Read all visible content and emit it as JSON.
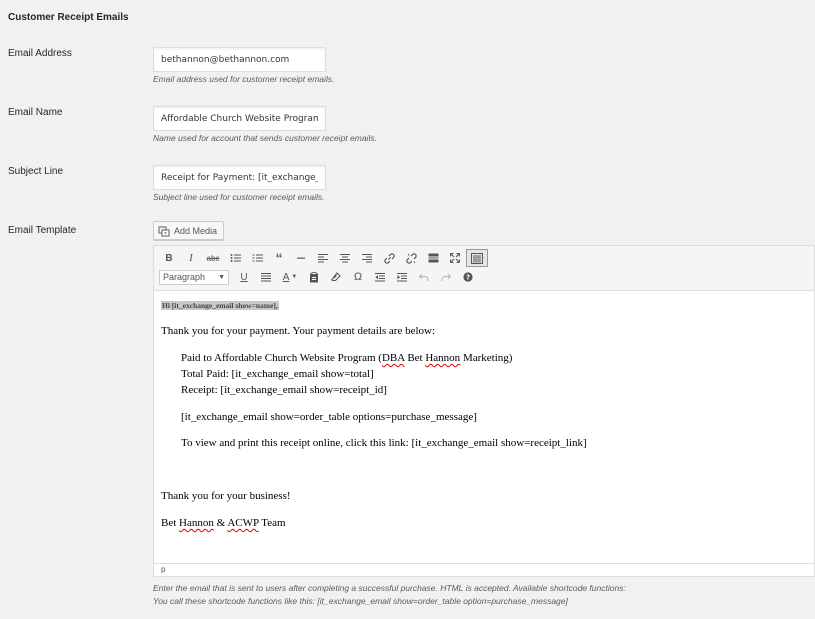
{
  "section": {
    "title": "Customer Receipt Emails"
  },
  "fields": {
    "email_address": {
      "label": "Email Address",
      "value": "bethannon@bethannon.com",
      "description": "Email address used for customer receipt emails."
    },
    "email_name": {
      "label": "Email Name",
      "value": "Affordable Church Website Program",
      "description": "Name used for account that sends customer receipt emails."
    },
    "subject_line": {
      "label": "Subject Line",
      "value": "Receipt for Payment: [it_exchange_email show=receipt_id]",
      "description": "Subject line used for customer receipt emails."
    },
    "email_template": {
      "label": "Email Template"
    }
  },
  "editor": {
    "add_media_label": "Add Media",
    "format_select": "Paragraph",
    "toolbar_row1_icons": [
      "bold-icon",
      "italic-icon",
      "strikethrough-icon",
      "bullet-list-icon",
      "numbered-list-icon",
      "blockquote-icon",
      "horizontal-line-icon",
      "align-left-icon",
      "align-center-icon",
      "align-right-icon",
      "link-icon",
      "unlink-icon",
      "read-more-icon",
      "fullscreen-icon",
      "toolbar-toggle-icon"
    ],
    "toolbar_row2_icons": [
      "underline-icon",
      "justify-icon",
      "text-color-icon",
      "paste-text-icon",
      "clear-formatting-icon",
      "special-character-icon",
      "outdent-icon",
      "indent-icon",
      "undo-icon",
      "redo-icon",
      "help-icon"
    ],
    "content": {
      "greeting": "Hi [it_exchange_email show=name],",
      "intro": "Thank you for your payment. Your payment details are below:",
      "paid_to_pre": "Paid to Affordable Church Website Program (",
      "paid_to_dba": "DBA",
      "paid_to_mid": " Bet ",
      "paid_to_hannon": "Hannon",
      "paid_to_post": " Marketing)",
      "total_paid": "Total Paid: [it_exchange_email show=total]",
      "receipt": "Receipt: [it_exchange_email show=receipt_id]",
      "order_table": "[it_exchange_email show=order_table options=purchase_message]",
      "view_online": "To view and print this receipt online, click this link: [it_exchange_email show=receipt_link]",
      "thanks": "Thank you for your business!",
      "sig_pre": "Bet ",
      "sig_hannon": "Hannon",
      "sig_mid": " & ",
      "sig_acwp": "ACWP",
      "sig_post": " Team"
    },
    "status_path": "p"
  },
  "help": {
    "line1": "Enter the email that is sent to users after completing a successful purchase. HTML is accepted. Available shortcode functions:",
    "line2": "You call these shortcode functions like this: [it_exchange_email show=order_table option=purchase_message]"
  }
}
